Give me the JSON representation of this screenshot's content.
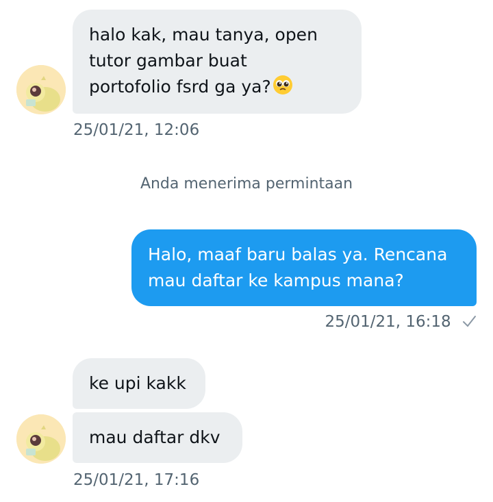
{
  "conversation": {
    "messages": [
      {
        "side": "incoming",
        "lines": [
          "halo kak, mau tanya, open",
          "tutor gambar buat",
          "portofolio fsrd ga ya?"
        ],
        "emoji": "pleading-face-emoji",
        "time": "25/01/21, 12:06"
      },
      {
        "side": "system",
        "text": "Anda menerima permintaan"
      },
      {
        "side": "outgoing",
        "lines": [
          "Halo, maaf baru balas ya. Rencana",
          "mau daftar ke kampus mana?"
        ],
        "time": "25/01/21, 16:18",
        "status_icon": "check-icon"
      },
      {
        "side": "incoming",
        "lines": [
          "ke upi kakk"
        ]
      },
      {
        "side": "incoming",
        "lines": [
          "mau daftar dkv"
        ],
        "time": "25/01/21, 17:16"
      }
    ]
  },
  "colors": {
    "incoming_bubble": "#ebeef0",
    "outgoing_bubble": "#1d9bf0",
    "timestamp": "#536471"
  },
  "icons": [
    "avatar-image",
    "pleading-face-emoji",
    "check-icon"
  ]
}
